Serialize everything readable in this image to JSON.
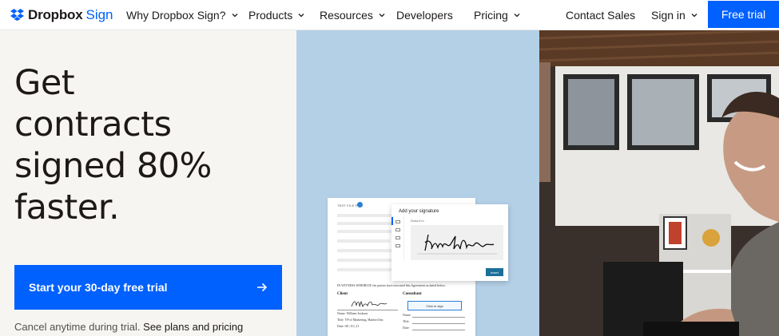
{
  "nav": {
    "brand": "Dropbox",
    "brand_product": "Sign",
    "items": [
      {
        "label": "Why Dropbox Sign?",
        "has_dropdown": true
      },
      {
        "label": "Products",
        "has_dropdown": true
      },
      {
        "label": "Resources",
        "has_dropdown": true
      },
      {
        "label": "Developers",
        "has_dropdown": false
      },
      {
        "label": "Pricing",
        "has_dropdown": true
      }
    ],
    "contact_sales": "Contact Sales",
    "sign_in": "Sign in",
    "free_trial": "Free trial"
  },
  "hero": {
    "headline_lines": [
      "Get",
      "contracts",
      "signed 80%",
      "faster."
    ],
    "cta_label": "Start your 30-day free trial",
    "cancel_text": "Cancel anytime during trial.",
    "plans_link": "See plans and pricing"
  },
  "illustration": {
    "doc_header": "TEST FILE.PDF",
    "witness_text": "IN WITNESS WHEREOF, the parties have executed this Agreement as dated below:",
    "client_label": "Client",
    "consultant_label": "Consultant",
    "client_name": "Name: William Jackson",
    "client_title": "Title: VP of Marketing, Hanford Inc",
    "client_date": "Date: 08 | 10 | 21",
    "consultant_name": "Name:",
    "consultant_title": "Title:",
    "consultant_date": "Date:",
    "click_to_sign": "Click to sign",
    "modal_title": "Add your signature",
    "modal_sub": "Draw it in",
    "insert_label": "Insert"
  },
  "colors": {
    "brand_blue": "#0061fe",
    "hero_bg": "#f7f5f2",
    "panel_blue": "#b4d0e7"
  }
}
